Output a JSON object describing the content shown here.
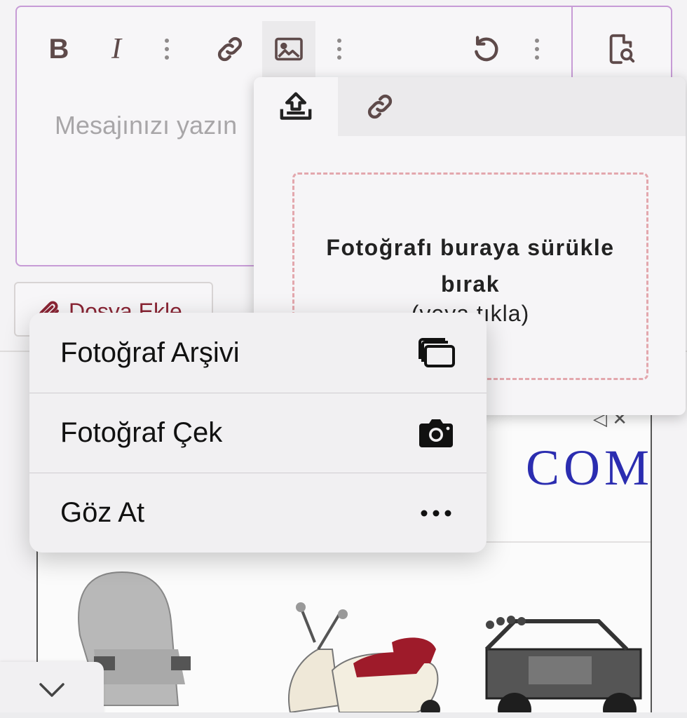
{
  "editor": {
    "placeholder": "Mesajınızı yazın",
    "toolbar": {
      "bold_label": "B",
      "italic_label": "I",
      "icons": [
        "more-vertical-icon",
        "link-icon",
        "image-icon",
        "more-vertical-icon",
        "undo-icon",
        "more-vertical-icon",
        "preview-icon"
      ]
    }
  },
  "attach_button": {
    "label": "Dosya Ekle",
    "icon": "paperclip-icon"
  },
  "image_popup": {
    "tabs": [
      {
        "icon": "upload-icon",
        "active": true
      },
      {
        "icon": "link-icon",
        "active": false
      }
    ],
    "dropzone_title": "Fotoğrafı buraya sürükle bırak",
    "dropzone_subtitle": "(veya tıkla)"
  },
  "action_menu": {
    "items": [
      {
        "label": "Fotoğraf Arşivi",
        "icon": "photo-library-icon"
      },
      {
        "label": "Fotoğraf Çek",
        "icon": "camera-icon"
      },
      {
        "label": "Göz At",
        "icon": "more-horizontal-icon"
      }
    ]
  },
  "ad": {
    "logo_text": "COM"
  },
  "colors": {
    "accent_border": "#c79bd6",
    "attach_text": "#8a2434",
    "dropzone_border": "#e3a7ad",
    "ad_logo": "#2b2db0"
  }
}
